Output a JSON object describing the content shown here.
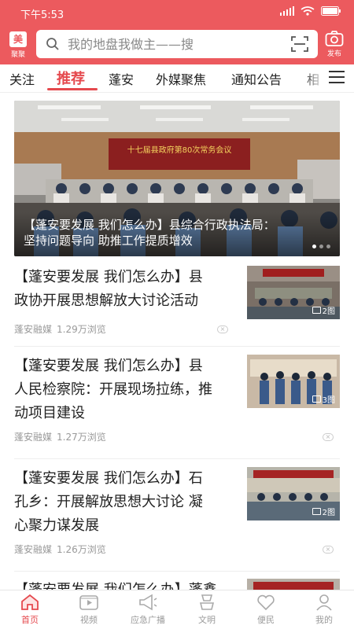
{
  "status_bar": {
    "time": "下午5:53"
  },
  "header": {
    "logo_label": "聚聚",
    "logo_glyph": "美",
    "search_placeholder": "我的地盘我做主——搜",
    "publish_label": "发布",
    "accent_color": "#ec5a5e"
  },
  "tabs": [
    {
      "label": "关注",
      "active": false
    },
    {
      "label": "推荐",
      "active": true
    },
    {
      "label": "蓬安",
      "active": false
    },
    {
      "label": "外媒聚焦",
      "active": false
    },
    {
      "label": "通知公告",
      "active": false
    },
    {
      "label": "相",
      "active": false
    }
  ],
  "hero": {
    "banner_text": "十七届县政府第80次常务会议",
    "caption_line1": "【蓬安要发展 我们怎么办】县综合行政执法局：",
    "caption_line2": "坚持问题导向 助推工作提质增效"
  },
  "articles": [
    {
      "title_line1": "【蓬安要发展 我们怎么办】县",
      "title_line2": "政协开展思想解放大讨论活动",
      "title_line3": "",
      "source": "蓬安融媒",
      "views": "1.29万浏览",
      "image_count": "2图"
    },
    {
      "title_line1": "【蓬安要发展 我们怎么办】县",
      "title_line2": "人民检察院：开展现场拉练，推",
      "title_line3": "动项目建设",
      "source": "蓬安融媒",
      "views": "1.27万浏览",
      "image_count": "3图"
    },
    {
      "title_line1": "【蓬安要发展 我们怎么办】石",
      "title_line2": "孔乡：开展解放思想大讨论 凝",
      "title_line3": "心聚力谋发展",
      "source": "蓬安融媒",
      "views": "1.26万浏览",
      "image_count": "2图"
    },
    {
      "title_line1": "【蓬安要发展 我们怎么办】蓬鑫",
      "title_line2": "",
      "title_line3": "",
      "source": "",
      "views": "",
      "image_count": ""
    }
  ],
  "bottom_nav": [
    {
      "label": "首页",
      "icon": "home-icon",
      "active": true
    },
    {
      "label": "视频",
      "icon": "video-icon",
      "active": false
    },
    {
      "label": "应急广播",
      "icon": "broadcast-icon",
      "active": false
    },
    {
      "label": "文明",
      "icon": "civilization-icon",
      "active": false
    },
    {
      "label": "便民",
      "icon": "heart-icon",
      "active": false
    },
    {
      "label": "我的",
      "icon": "user-icon",
      "active": false
    }
  ]
}
